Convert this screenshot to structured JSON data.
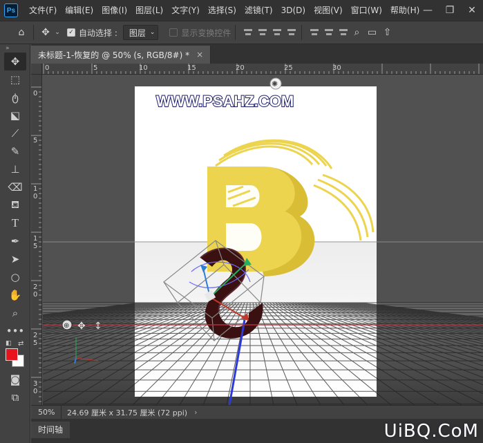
{
  "app": {
    "logo": "Ps"
  },
  "menu": [
    "文件(F)",
    "编辑(E)",
    "图像(I)",
    "图层(L)",
    "文字(Y)",
    "选择(S)",
    "滤镜(T)",
    "3D(D)",
    "视图(V)",
    "窗口(W)",
    "帮助(H)"
  ],
  "options": {
    "auto_select_label": "自动选择 :",
    "layer_select_value": "图层",
    "show_transform_label": "显示变换控件"
  },
  "toolbar": {
    "collapse": "»"
  },
  "document": {
    "tab_title": "未标题-1-恢复的 @ 50% (s, RGB/8#) *",
    "close": "×"
  },
  "rulers": {
    "top": [
      "0",
      "5",
      "10",
      "15",
      "20",
      "25",
      "30"
    ],
    "left": [
      "0",
      "5",
      "1 0",
      "1 5",
      "2 0",
      "2 5",
      "3 0"
    ]
  },
  "canvas": {
    "watermark_text": "WWW.PSAHZ.COM",
    "colors": {
      "paper": "#ffffff",
      "letter_b": "#ecd44e",
      "letter_s": "#3a1010",
      "grid": "#1a1a1a",
      "x_axis": "#c0392b",
      "y_axis": "#27ae60",
      "z_axis": "#2c3ad6"
    }
  },
  "status": {
    "zoom": "50%",
    "doc_size": "24.69 厘米 x 31.75 厘米 (72 ppi)",
    "chevron": "›"
  },
  "timeline": {
    "tab": "时间轴"
  },
  "watermark": "UiBQ.CoM",
  "colors": {
    "foreground": "#e8141b",
    "background": "#ffffff"
  }
}
